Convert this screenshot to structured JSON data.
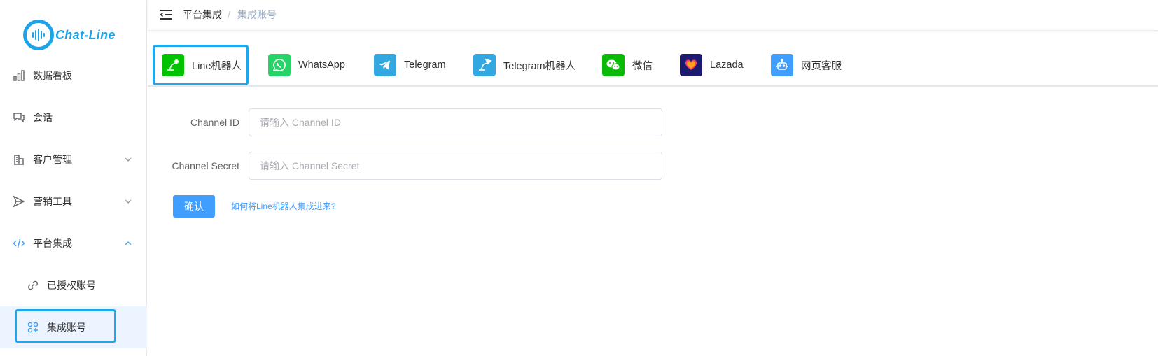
{
  "app": {
    "logo_text": "Chat-Line"
  },
  "sidebar": {
    "items": [
      {
        "label": "数据看板",
        "icon": "bar-chart-icon"
      },
      {
        "label": "会话",
        "icon": "chat-bubbles-icon"
      },
      {
        "label": "客户管理",
        "icon": "building-icon"
      },
      {
        "label": "营销工具",
        "icon": "send-icon"
      },
      {
        "label": "平台集成",
        "icon": "code-icon"
      },
      {
        "label": "已授权账号",
        "icon": "link-icon"
      },
      {
        "label": "集成账号",
        "icon": "apps-add-icon"
      }
    ]
  },
  "header": {
    "breadcrumb": [
      "平台集成",
      "集成账号"
    ],
    "separator": "/"
  },
  "tabs": [
    {
      "label": "Line机器人",
      "icon": "line-bot-icon",
      "color": "#00c300"
    },
    {
      "label": "WhatsApp",
      "icon": "whatsapp-icon",
      "color": "#25d366"
    },
    {
      "label": "Telegram",
      "icon": "telegram-icon",
      "color": "#33a8e0"
    },
    {
      "label": "Telegram机器人",
      "icon": "telegram-bot-icon",
      "color": "#33a8e0"
    },
    {
      "label": "微信",
      "icon": "wechat-icon",
      "color": "#09bb07"
    },
    {
      "label": "Lazada",
      "icon": "lazada-icon",
      "color": "#1b1a6e"
    },
    {
      "label": "网页客服",
      "icon": "robot-icon",
      "color": "#409eff"
    }
  ],
  "form": {
    "channel_id": {
      "label": "Channel ID",
      "value": "",
      "placeholder": "请输入 Channel ID"
    },
    "channel_secret": {
      "label": "Channel Secret",
      "value": "",
      "placeholder": "请输入 Channel Secret"
    },
    "confirm_label": "确认",
    "help_link": "如何将Line机器人集成进来?"
  },
  "colors": {
    "accent": "#409eff",
    "highlight": "#1ea7ea",
    "brand": "#1fa3e8"
  }
}
